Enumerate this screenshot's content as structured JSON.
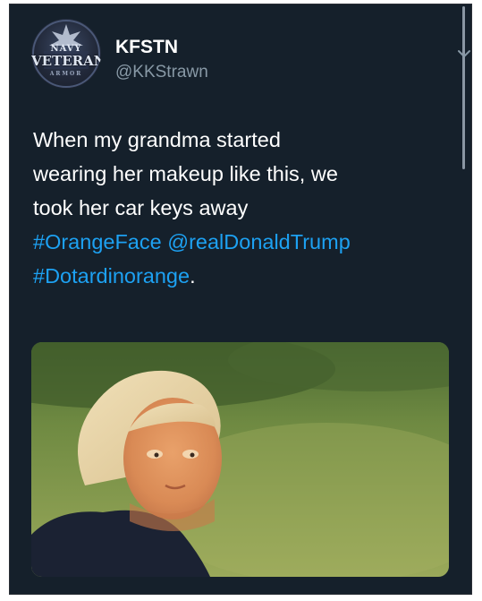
{
  "tweet": {
    "avatar": {
      "icon": "navy-veteran-logo-icon",
      "text_top": "NAVY",
      "text_main": "VETERAN",
      "text_bottom": "ARMOR"
    },
    "display_name": "KFSTN",
    "handle": "@KKStrawn",
    "menu_icon": "chevron-down-icon",
    "text": {
      "line1": "When my grandma started",
      "line2": "wearing her makeup like this, we",
      "line3": "took her car keys away",
      "hashtag1": "#OrangeFace",
      "mention": "@realDonaldTrump",
      "hashtag2": "#Dotardinorange",
      "trailing": "."
    },
    "image": {
      "icon": "photo-image"
    }
  },
  "colors": {
    "background": "#15202b",
    "text": "#ffffff",
    "secondary_text": "#8899a6",
    "link": "#1da1f2"
  }
}
